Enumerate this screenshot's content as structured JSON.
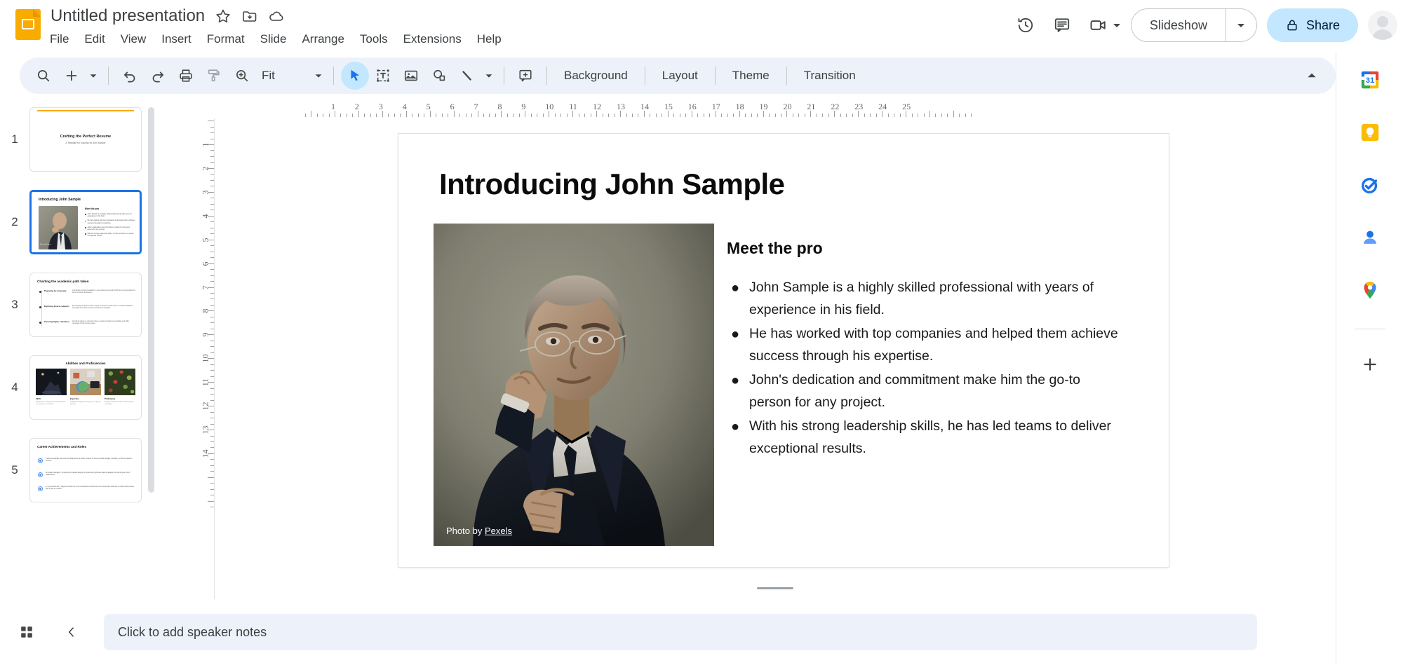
{
  "app": {
    "logo_icon": "google-slides-logo",
    "title": "Untitled presentation",
    "title_icons": [
      "star-icon",
      "move-to-folder-icon",
      "cloud-saved-icon"
    ]
  },
  "menubar": {
    "items": [
      "File",
      "Edit",
      "View",
      "Insert",
      "Format",
      "Slide",
      "Arrange",
      "Tools",
      "Extensions",
      "Help"
    ]
  },
  "topright": {
    "history_icon": "version-history-icon",
    "comments_icon": "comment-icon",
    "meet_icon": "video-camera-icon",
    "meet_caret_icon": "chevron-down-icon",
    "slideshow_label": "Slideshow",
    "slideshow_caret_icon": "chevron-down-icon",
    "share_lock_icon": "lock-icon",
    "share_label": "Share",
    "avatar": "user-avatar"
  },
  "toolbar": {
    "search_icon": "search-icon",
    "new_slide_icon": "plus-icon",
    "new_slide_caret_icon": "chevron-down-icon",
    "undo_icon": "undo-icon",
    "redo_icon": "redo-icon",
    "print_icon": "printer-icon",
    "paint_icon": "paint-format-icon",
    "zoom_icon": "zoom-icon",
    "zoom_value": "Fit",
    "zoom_caret_icon": "chevron-down-icon",
    "select_icon": "cursor-arrow-icon",
    "textbox_icon": "text-box-icon",
    "image_icon": "insert-image-icon",
    "shape_icon": "shape-icon",
    "line_icon": "line-icon",
    "line_caret_icon": "chevron-down-icon",
    "comment_icon": "add-comment-icon",
    "background_label": "Background",
    "layout_label": "Layout",
    "theme_label": "Theme",
    "transition_label": "Transition",
    "collapse_icon": "chevron-up-icon"
  },
  "filmstrip": {
    "slides": [
      {
        "number": "1",
        "selected": false,
        "kind": "title",
        "title": "Crafting the Perfect Resume",
        "subtitle": "A Template for Success by John Sample"
      },
      {
        "number": "2",
        "selected": true,
        "kind": "photo-bullets",
        "title": "Introducing John Sample",
        "head": "Meet the pro",
        "credit": "Photo by Pexels",
        "bullets": [
          "John Sample is a highly skilled professional with years of experience in his field.",
          "He has worked with top companies and helped them achieve success through his expertise.",
          "John's dedication and commitment make him the go-to person for any project.",
          "With his strong leadership skills, he has led teams to deliver exceptional results."
        ]
      },
      {
        "number": "3",
        "selected": false,
        "kind": "timeline",
        "title": "Charting the academic path taken",
        "rows": [
          {
            "label": "Preparing for university",
            "text": "Completing a strong foundation in core subjects and math which lays the groundwork for future university admissions."
          },
          {
            "label": "Exploring diverse subjects",
            "text": "Encouraging students to take a range of courses exposes them to various disciplines and helps them discover their interests and strengths."
          },
          {
            "label": "Pursuing higher education",
            "text": "Attending college or university where a major provides the knowledge and skills necessary for the chosen career."
          }
        ]
      },
      {
        "number": "4",
        "selected": false,
        "kind": "three-cards",
        "title": "Abilities and Proficiencies",
        "cards": [
          {
            "head": "Skills",
            "text": "Sample lists a variety of skills acquired from his experience in the field."
          },
          {
            "head": "Expertise",
            "text": "In-depth knowledge and expertise in specific domains."
          },
          {
            "head": "Proficiency",
            "text": "A strong command of tools and techniques used daily."
          }
        ]
      },
      {
        "number": "5",
        "selected": false,
        "kind": "achievements",
        "title": "Career Achievements and Roles",
        "rows": [
          "I have successfully led cross-functional teams to deliver projects on time and within budget, resulting in a 30% increase in revenue.",
          "As a sales manager, I consistently exceeded targets by implementing effective sales strategies and nurturing key client relationships.",
          "In my previous role, I played a crucial role in the development and launch of a new product which led to a 20% market share gain in just six months."
        ]
      }
    ]
  },
  "rulers": {
    "horizontal": [
      "1",
      "2",
      "3",
      "4",
      "5",
      "6",
      "7",
      "8",
      "9",
      "10",
      "11",
      "12",
      "13",
      "14",
      "15",
      "16",
      "17",
      "18",
      "19",
      "20",
      "21",
      "22",
      "23",
      "24",
      "25"
    ],
    "vertical": [
      "1",
      "2",
      "3",
      "4",
      "5",
      "6",
      "7",
      "8",
      "9",
      "10",
      "11",
      "12",
      "13",
      "14"
    ]
  },
  "slide": {
    "title": "Introducing John Sample",
    "body_head": "Meet the pro",
    "bullets": [
      "John Sample is a highly skilled professional with years of experience in his field.",
      "He has worked with top companies and helped them achieve success through his expertise.",
      "John's dedication and commitment make him the go-to person for any project.",
      "With his strong leadership skills, he has led teams to deliver exceptional results."
    ],
    "bullet_glyph": "●",
    "photo": {
      "alt": "portrait-of-man-in-dark-suit-adjusting-glasses",
      "credit_prefix": "Photo by ",
      "credit_link": "Pexels"
    }
  },
  "bottombar": {
    "grid_icon": "grid-view-icon",
    "collapse_icon": "chevron-left-icon",
    "notes_placeholder": "Click to add speaker notes"
  },
  "rightpanel": {
    "items": [
      {
        "icon": "google-calendar-icon",
        "label": "Calendar",
        "badge": "31"
      },
      {
        "icon": "google-keep-icon",
        "label": "Keep"
      },
      {
        "icon": "google-tasks-icon",
        "label": "Tasks"
      },
      {
        "icon": "google-contacts-icon",
        "label": "Contacts"
      },
      {
        "icon": "google-maps-icon",
        "label": "Maps"
      }
    ],
    "add_icon": "plus-icon"
  },
  "colors": {
    "accent_blue": "#1a73e8",
    "toolbar_bg": "#edf2fa",
    "share_bg": "#c2e7ff",
    "logo_yellow": "#f9ab00",
    "slide1_rule": "#f9ab00"
  }
}
